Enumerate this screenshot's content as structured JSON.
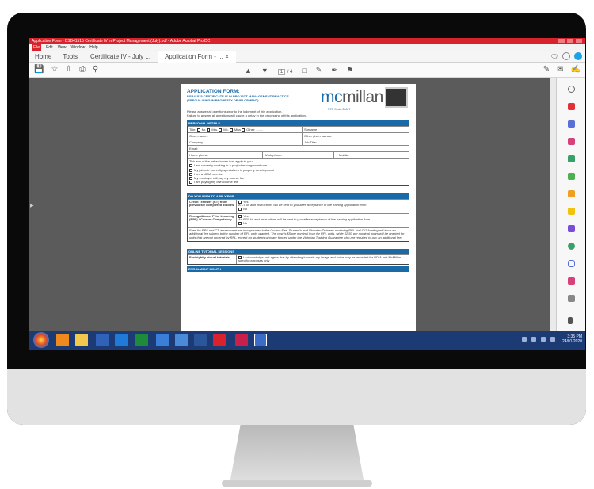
{
  "window": {
    "title": "Application Form - BSB41515 Certificate IV in Project Management (July).pdf - Adobe Acrobat Pro DC"
  },
  "menu": [
    "File",
    "Edit",
    "View",
    "Window",
    "Help"
  ],
  "tabs": {
    "home": "Home",
    "tools": "Tools",
    "doc1": "Certificate IV - July ...",
    "doc2": "Application Form - ...",
    "close": "×"
  },
  "toolbar": {
    "page_current": "1",
    "page_total": "/ 4"
  },
  "form": {
    "title": "APPLICATION FORM:",
    "subtitle1": "BSB41515 CERTIFICATE IV IN PROJECT MANAGEMENT PRACTICE",
    "subtitle2": "(SPECIALISING IN PROPERTY DEVELOPMENT)",
    "logo_a": "mc",
    "logo_b": "millan",
    "rto": "RTO Code: 80067",
    "intro1": "Please answer all questions prior to the lodgment of this application.",
    "intro2": "Failure to answer all questions will cause a delay in the processing of this application.",
    "personal": {
      "header": "PERSONAL DETAILS",
      "title_label": "Title:",
      "titles": [
        "Mr.",
        "Mrs.",
        "Ms.",
        "Miss",
        "Other: ........"
      ],
      "surname": "Surname",
      "given": "Given name:",
      "other_given": "Other given names:",
      "company": "Company",
      "job": "Job Title:",
      "email": "Email:",
      "home_phone": "Home phone",
      "work_phone": "Work phone:",
      "mobile": "Mobile:",
      "tick_label": "Tick any of the below boxes that apply to you:",
      "ticks": [
        "I am currently working in a project management role",
        "My job role currently specializes in property development",
        "I am a UDIA member",
        "My employer will pay my course fee",
        "I am paying my own course fee"
      ]
    },
    "apply": {
      "header": "DO YOU WISH TO APPLY FOR",
      "ct_label": "Credit Transfer (CT) from previously completed studies",
      "ct_yes": "Yes",
      "ct_note": "A CT kit and instructions will be sent to you after acceptance of the training application form",
      "ct_no": "No",
      "rpl_label": "Recognition of Prior Learning (RPL) / Current Competency",
      "rpl_yes": "Yes",
      "rpl_note": "An RPL kit and instructions will be sent to you after acceptance of the training application form",
      "rpl_no": "No",
      "fees": "Fees for RPL and CT assessment are incorporated in the Course Fee. Student's and Victorian Trainees receiving RPL via VTG funding will incur an additional fee subject to the number of RPL units granted. The cost is $5 per nominal hour for RPL units, while $2.50 per nominal hours will be granted for units that are not covered by RPL, except for students who are funded under the Victorian Training Guarantee who are required to pay an additional fee."
    },
    "online": {
      "header": "ONLINE TUTORIAL SESSIONS",
      "label": "Fortnightly virtual tutorials:",
      "text": "I acknowledge and agree that by attending tutorials my image and voice may be recorded for UDIA and McMillan specific purposes only"
    },
    "enrol": {
      "header": "ENROLMENT MONTH"
    }
  },
  "clock": {
    "time": "3:35 PM",
    "date": "24/01/2020"
  },
  "colors": {
    "titlebar": "#d8222c",
    "accent": "#1b6aa8",
    "taskbar": "#1c3a73"
  }
}
